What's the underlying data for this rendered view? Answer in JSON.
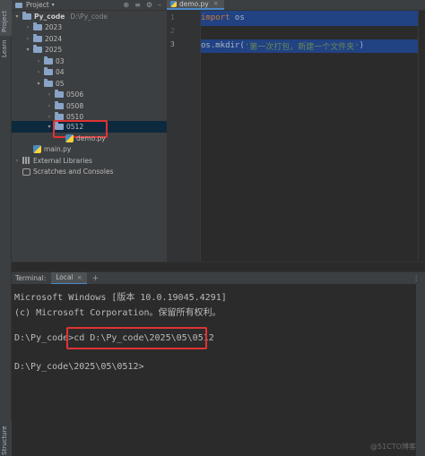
{
  "side_strip": {
    "project_label": "Project",
    "learn_label": "Learn",
    "structure_label": "Structure"
  },
  "project_panel": {
    "header_label": "Project",
    "tree": [
      {
        "label": "Py_code",
        "suffix": "D:\\Py_code",
        "kind": "folder",
        "expanded": true
      },
      {
        "label": "2023",
        "kind": "folder",
        "expanded": false
      },
      {
        "label": "2024",
        "kind": "folder",
        "expanded": false
      },
      {
        "label": "2025",
        "kind": "folder",
        "expanded": true
      },
      {
        "label": "03",
        "kind": "folder",
        "expanded": false
      },
      {
        "label": "04",
        "kind": "folder",
        "expanded": false
      },
      {
        "label": "05",
        "kind": "folder",
        "expanded": true
      },
      {
        "label": "0506",
        "kind": "folder",
        "expanded": false
      },
      {
        "label": "0508",
        "kind": "folder",
        "expanded": false
      },
      {
        "label": "0510",
        "kind": "folder",
        "expanded": false
      },
      {
        "label": "0512",
        "kind": "folder",
        "expanded": true,
        "selected": true
      },
      {
        "label": "demo.py",
        "kind": "python"
      },
      {
        "label": "main.py",
        "kind": "python"
      },
      {
        "label": "External Libraries",
        "kind": "library",
        "expanded": false
      },
      {
        "label": "Scratches and Consoles",
        "kind": "scratch"
      }
    ]
  },
  "editor": {
    "tab_label": "demo.py",
    "line_numbers": [
      "1",
      "2",
      "3"
    ],
    "code": {
      "line1_kw": "import",
      "line1_rest": " os",
      "line3_call": "os.mkdir(",
      "line3_str": "'第一次打包，新建一个文件夹'",
      "line3_end": ")"
    }
  },
  "terminal": {
    "header_label": "Terminal:",
    "tab_label": "Local",
    "lines": [
      "Microsoft Windows [版本 10.0.19045.4291]",
      "(c) Microsoft Corporation。保留所有权利。",
      "",
      "D:\\Py_code>cd D:\\Py_code\\2025\\05\\0512",
      "",
      "D:\\Py_code\\2025\\05\\0512>"
    ]
  },
  "watermark": "@51CTO博客",
  "colors": {
    "highlight": "#214283",
    "keyword": "#cc7832",
    "string": "#6a8759",
    "annotation_box": "#e03333"
  }
}
